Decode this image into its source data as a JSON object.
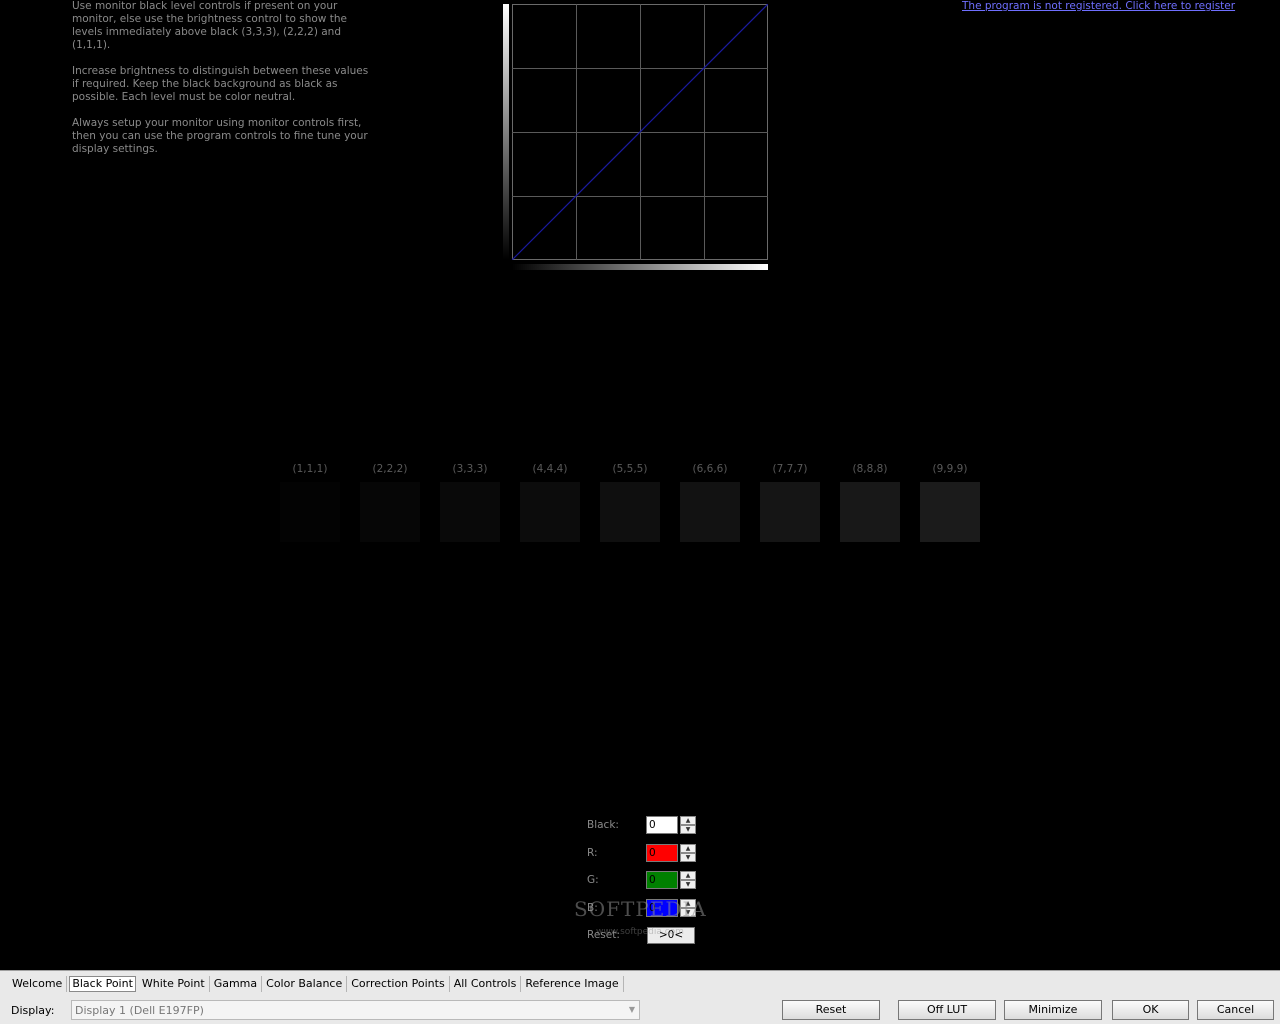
{
  "instructions": [
    "Use monitor black level controls if present on your monitor, else use the brightness control to show the levels immediately above black (3,3,3), (2,2,2) and (1,1,1).",
    "Increase brightness to distinguish between these values if required. Keep the black background as black as possible. Each level must be color neutral.",
    "Always setup your monitor using monitor controls first, then you can use the program controls to fine tune your display settings."
  ],
  "register_link": "The program is not registered. Click here to register",
  "levels": [
    {
      "label": "(1,1,1)",
      "value": 1
    },
    {
      "label": "(2,2,2)",
      "value": 2
    },
    {
      "label": "(3,3,3)",
      "value": 3
    },
    {
      "label": "(4,4,4)",
      "value": 4
    },
    {
      "label": "(5,5,5)",
      "value": 5
    },
    {
      "label": "(6,6,6)",
      "value": 6
    },
    {
      "label": "(7,7,7)",
      "value": 7
    },
    {
      "label": "(8,8,8)",
      "value": 8
    },
    {
      "label": "(9,9,9)",
      "value": 9
    }
  ],
  "controls": {
    "black": {
      "label": "Black:",
      "value": "0",
      "color": "#ffffff"
    },
    "r": {
      "label": "R:",
      "value": "0",
      "color": "#ff0000"
    },
    "g": {
      "label": "G:",
      "value": "0",
      "color": "#008000"
    },
    "b": {
      "label": "B:",
      "value": "0",
      "color": "#0000ff"
    },
    "reset": {
      "label": "Reset:",
      "button": ">0<"
    }
  },
  "watermark": {
    "text": "SOFTPEDIA",
    "url": "www.softpedia.com"
  },
  "tabs": [
    {
      "label": "Welcome",
      "active": false
    },
    {
      "label": "Black Point",
      "active": true
    },
    {
      "label": "White Point",
      "active": false
    },
    {
      "label": "Gamma",
      "active": false
    },
    {
      "label": "Color Balance",
      "active": false
    },
    {
      "label": "Correction Points",
      "active": false
    },
    {
      "label": "All Controls",
      "active": false
    },
    {
      "label": "Reference Image",
      "active": false
    }
  ],
  "display": {
    "label": "Display:",
    "value": "Display 1 (Dell E197FP)"
  },
  "buttons": {
    "reset": "Reset",
    "off_lut": "Off LUT",
    "minimize": "Minimize",
    "ok": "OK",
    "cancel": "Cancel"
  },
  "curve": {
    "line_color": "#1a1aa0",
    "grid_color": "#5a5a5a",
    "divisions": 4
  }
}
